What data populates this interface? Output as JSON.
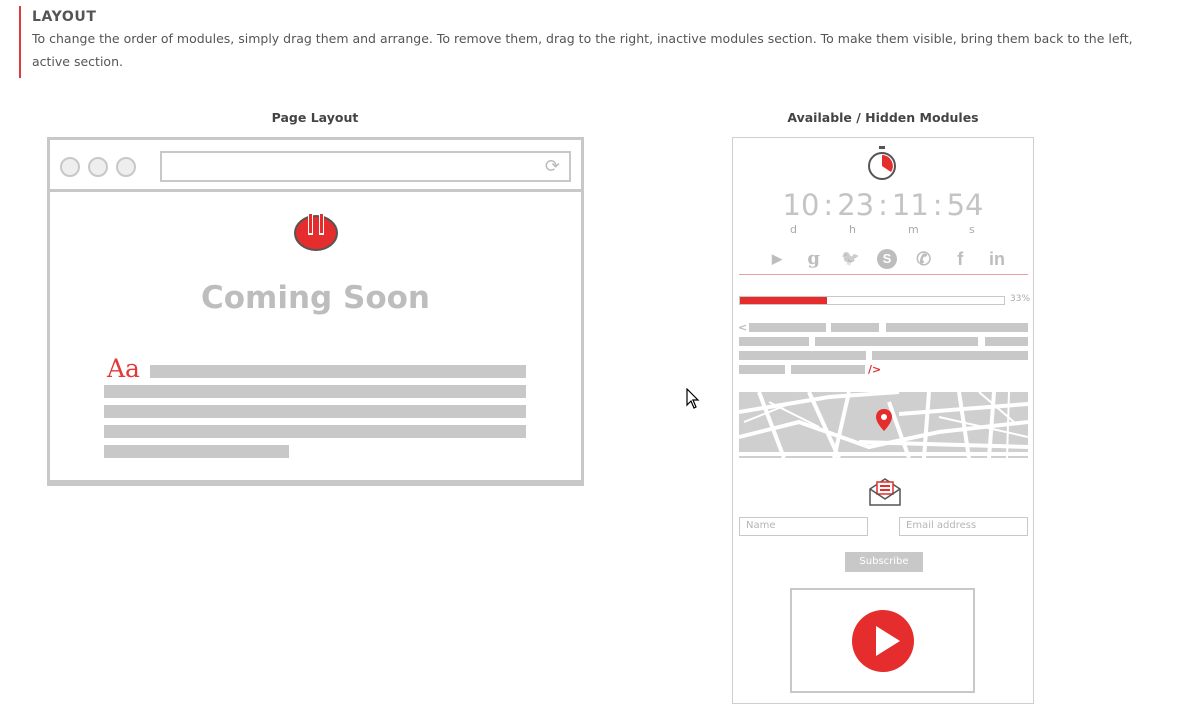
{
  "section": {
    "title": "LAYOUT",
    "description": "To change the order of modules, simply drag them and arrange. To remove them, drag to the right, inactive modules section. To make them visible, bring them back to the left, active section."
  },
  "page_layout": {
    "title": "Page Layout",
    "heading": "Coming Soon",
    "font_sample": "Aa",
    "icons": [
      "window-dot-icon",
      "refresh-icon",
      "logo-icon"
    ]
  },
  "modules": {
    "title": "Available / Hidden Modules",
    "countdown": {
      "days": "10",
      "hours": "23",
      "minutes": "11",
      "seconds": "54",
      "separator": ":",
      "labels": {
        "d": "d",
        "h": "h",
        "m": "m",
        "s": "s"
      }
    },
    "social_icons": [
      {
        "name": "youtube-icon",
        "glyph": "▶"
      },
      {
        "name": "google-icon",
        "glyph": "g"
      },
      {
        "name": "twitter-icon",
        "glyph": "🐦"
      },
      {
        "name": "skype-icon",
        "glyph": "S"
      },
      {
        "name": "whatsapp-icon",
        "glyph": "✆"
      },
      {
        "name": "facebook-icon",
        "glyph": "f"
      },
      {
        "name": "linkedin-icon",
        "glyph": "in"
      }
    ],
    "progress": {
      "value": 33,
      "label": "33%"
    },
    "text_open": "<",
    "text_close": "/>",
    "name_placeholder": "Name",
    "email_placeholder": "Email address",
    "subscribe_label": "Subscribe"
  },
  "colors": {
    "accent": "#e52d2d",
    "placeholder_gray": "#c8c8c8",
    "text": "#555555"
  }
}
